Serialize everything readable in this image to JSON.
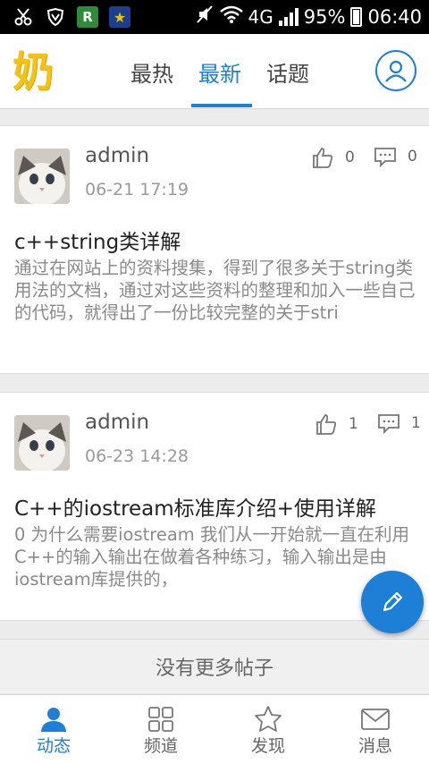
{
  "status_bar": {
    "battery": "95%",
    "time": "06:40",
    "network": "4G",
    "icons": [
      "scissors-icon",
      "shield-icon",
      "r-app-icon",
      "star-app-icon",
      "mute-icon",
      "wifi-icon",
      "signal-icon",
      "battery-icon"
    ]
  },
  "header": {
    "logo_text": "奶",
    "tabs": [
      {
        "label": "最热",
        "active": false
      },
      {
        "label": "最新",
        "active": true
      },
      {
        "label": "话题",
        "active": false
      }
    ],
    "accent": "#1d7fd6"
  },
  "posts": [
    {
      "author": "admin",
      "time": "06-21 17:19",
      "likes": "0",
      "comments": "0",
      "title": "c++string类详解",
      "excerpt": "通过在网站上的资料搜集，得到了很多关于string类用法的文档，通过对这些资料的整理和加入一些自己的代码，就得出了一份比较完整的关于stri"
    },
    {
      "author": "admin",
      "time": "06-23 14:28",
      "likes": "1",
      "comments": "1",
      "title": "C++的iostream标准库介绍+使用详解",
      "excerpt": "0 为什么需要iostream 我们从一开始就一直在利用C++的输入输出在做着各种练习，输入输出是由iostream库提供的，"
    }
  ],
  "no_more_label": "没有更多帖子",
  "bottom_nav": [
    {
      "label": "动态",
      "icon": "user-icon",
      "active": true
    },
    {
      "label": "频道",
      "icon": "grid-icon",
      "active": false
    },
    {
      "label": "发现",
      "icon": "star-outline-icon",
      "active": false
    },
    {
      "label": "消息",
      "icon": "mail-icon",
      "active": false
    }
  ]
}
